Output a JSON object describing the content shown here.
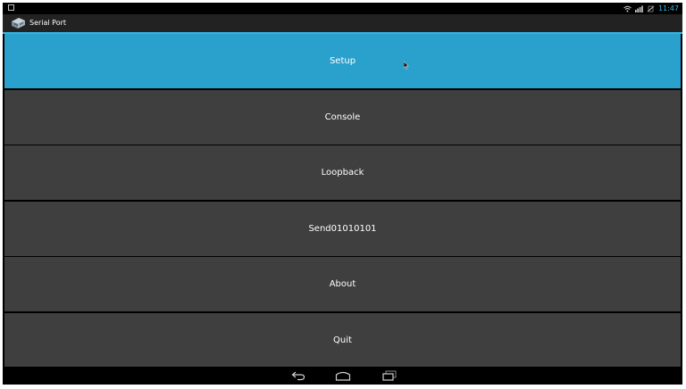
{
  "status_bar": {
    "notification_icon": "notification-square-icon",
    "wifi_icon": "wifi-icon",
    "signal_icon": "signal-icon",
    "battery_icon": "battery-icon",
    "time": "11:47"
  },
  "action_bar": {
    "app_icon": "serial-port-icon",
    "title": "Serial Port",
    "accent_color": "#33b5e5"
  },
  "menu": {
    "items": [
      {
        "label": "Setup",
        "selected": true
      },
      {
        "label": "Console",
        "selected": false
      },
      {
        "label": "Loopback",
        "selected": false
      },
      {
        "label": "Send01010101",
        "selected": false
      },
      {
        "label": "About",
        "selected": false
      },
      {
        "label": "Quit",
        "selected": false
      }
    ],
    "selected_color": "#2aa1cc",
    "default_color": "#3f3f3f"
  },
  "nav_bar": {
    "back_icon": "back-icon",
    "home_icon": "home-icon",
    "recents_icon": "recents-icon"
  }
}
